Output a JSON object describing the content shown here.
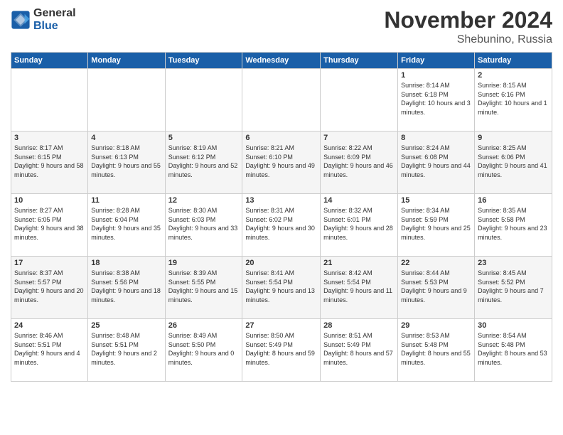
{
  "header": {
    "logo_text_general": "General",
    "logo_text_blue": "Blue",
    "month_title": "November 2024",
    "location": "Shebunino, Russia"
  },
  "days_of_week": [
    "Sunday",
    "Monday",
    "Tuesday",
    "Wednesday",
    "Thursday",
    "Friday",
    "Saturday"
  ],
  "weeks": [
    [
      {
        "day": "",
        "sunrise": "",
        "sunset": "",
        "daylight": ""
      },
      {
        "day": "",
        "sunrise": "",
        "sunset": "",
        "daylight": ""
      },
      {
        "day": "",
        "sunrise": "",
        "sunset": "",
        "daylight": ""
      },
      {
        "day": "",
        "sunrise": "",
        "sunset": "",
        "daylight": ""
      },
      {
        "day": "",
        "sunrise": "",
        "sunset": "",
        "daylight": ""
      },
      {
        "day": "1",
        "sunrise": "Sunrise: 8:14 AM",
        "sunset": "Sunset: 6:18 PM",
        "daylight": "Daylight: 10 hours and 3 minutes."
      },
      {
        "day": "2",
        "sunrise": "Sunrise: 8:15 AM",
        "sunset": "Sunset: 6:16 PM",
        "daylight": "Daylight: 10 hours and 1 minute."
      }
    ],
    [
      {
        "day": "3",
        "sunrise": "Sunrise: 8:17 AM",
        "sunset": "Sunset: 6:15 PM",
        "daylight": "Daylight: 9 hours and 58 minutes."
      },
      {
        "day": "4",
        "sunrise": "Sunrise: 8:18 AM",
        "sunset": "Sunset: 6:13 PM",
        "daylight": "Daylight: 9 hours and 55 minutes."
      },
      {
        "day": "5",
        "sunrise": "Sunrise: 8:19 AM",
        "sunset": "Sunset: 6:12 PM",
        "daylight": "Daylight: 9 hours and 52 minutes."
      },
      {
        "day": "6",
        "sunrise": "Sunrise: 8:21 AM",
        "sunset": "Sunset: 6:10 PM",
        "daylight": "Daylight: 9 hours and 49 minutes."
      },
      {
        "day": "7",
        "sunrise": "Sunrise: 8:22 AM",
        "sunset": "Sunset: 6:09 PM",
        "daylight": "Daylight: 9 hours and 46 minutes."
      },
      {
        "day": "8",
        "sunrise": "Sunrise: 8:24 AM",
        "sunset": "Sunset: 6:08 PM",
        "daylight": "Daylight: 9 hours and 44 minutes."
      },
      {
        "day": "9",
        "sunrise": "Sunrise: 8:25 AM",
        "sunset": "Sunset: 6:06 PM",
        "daylight": "Daylight: 9 hours and 41 minutes."
      }
    ],
    [
      {
        "day": "10",
        "sunrise": "Sunrise: 8:27 AM",
        "sunset": "Sunset: 6:05 PM",
        "daylight": "Daylight: 9 hours and 38 minutes."
      },
      {
        "day": "11",
        "sunrise": "Sunrise: 8:28 AM",
        "sunset": "Sunset: 6:04 PM",
        "daylight": "Daylight: 9 hours and 35 minutes."
      },
      {
        "day": "12",
        "sunrise": "Sunrise: 8:30 AM",
        "sunset": "Sunset: 6:03 PM",
        "daylight": "Daylight: 9 hours and 33 minutes."
      },
      {
        "day": "13",
        "sunrise": "Sunrise: 8:31 AM",
        "sunset": "Sunset: 6:02 PM",
        "daylight": "Daylight: 9 hours and 30 minutes."
      },
      {
        "day": "14",
        "sunrise": "Sunrise: 8:32 AM",
        "sunset": "Sunset: 6:01 PM",
        "daylight": "Daylight: 9 hours and 28 minutes."
      },
      {
        "day": "15",
        "sunrise": "Sunrise: 8:34 AM",
        "sunset": "Sunset: 5:59 PM",
        "daylight": "Daylight: 9 hours and 25 minutes."
      },
      {
        "day": "16",
        "sunrise": "Sunrise: 8:35 AM",
        "sunset": "Sunset: 5:58 PM",
        "daylight": "Daylight: 9 hours and 23 minutes."
      }
    ],
    [
      {
        "day": "17",
        "sunrise": "Sunrise: 8:37 AM",
        "sunset": "Sunset: 5:57 PM",
        "daylight": "Daylight: 9 hours and 20 minutes."
      },
      {
        "day": "18",
        "sunrise": "Sunrise: 8:38 AM",
        "sunset": "Sunset: 5:56 PM",
        "daylight": "Daylight: 9 hours and 18 minutes."
      },
      {
        "day": "19",
        "sunrise": "Sunrise: 8:39 AM",
        "sunset": "Sunset: 5:55 PM",
        "daylight": "Daylight: 9 hours and 15 minutes."
      },
      {
        "day": "20",
        "sunrise": "Sunrise: 8:41 AM",
        "sunset": "Sunset: 5:54 PM",
        "daylight": "Daylight: 9 hours and 13 minutes."
      },
      {
        "day": "21",
        "sunrise": "Sunrise: 8:42 AM",
        "sunset": "Sunset: 5:54 PM",
        "daylight": "Daylight: 9 hours and 11 minutes."
      },
      {
        "day": "22",
        "sunrise": "Sunrise: 8:44 AM",
        "sunset": "Sunset: 5:53 PM",
        "daylight": "Daylight: 9 hours and 9 minutes."
      },
      {
        "day": "23",
        "sunrise": "Sunrise: 8:45 AM",
        "sunset": "Sunset: 5:52 PM",
        "daylight": "Daylight: 9 hours and 7 minutes."
      }
    ],
    [
      {
        "day": "24",
        "sunrise": "Sunrise: 8:46 AM",
        "sunset": "Sunset: 5:51 PM",
        "daylight": "Daylight: 9 hours and 4 minutes."
      },
      {
        "day": "25",
        "sunrise": "Sunrise: 8:48 AM",
        "sunset": "Sunset: 5:51 PM",
        "daylight": "Daylight: 9 hours and 2 minutes."
      },
      {
        "day": "26",
        "sunrise": "Sunrise: 8:49 AM",
        "sunset": "Sunset: 5:50 PM",
        "daylight": "Daylight: 9 hours and 0 minutes."
      },
      {
        "day": "27",
        "sunrise": "Sunrise: 8:50 AM",
        "sunset": "Sunset: 5:49 PM",
        "daylight": "Daylight: 8 hours and 59 minutes."
      },
      {
        "day": "28",
        "sunrise": "Sunrise: 8:51 AM",
        "sunset": "Sunset: 5:49 PM",
        "daylight": "Daylight: 8 hours and 57 minutes."
      },
      {
        "day": "29",
        "sunrise": "Sunrise: 8:53 AM",
        "sunset": "Sunset: 5:48 PM",
        "daylight": "Daylight: 8 hours and 55 minutes."
      },
      {
        "day": "30",
        "sunrise": "Sunrise: 8:54 AM",
        "sunset": "Sunset: 5:48 PM",
        "daylight": "Daylight: 8 hours and 53 minutes."
      }
    ]
  ]
}
